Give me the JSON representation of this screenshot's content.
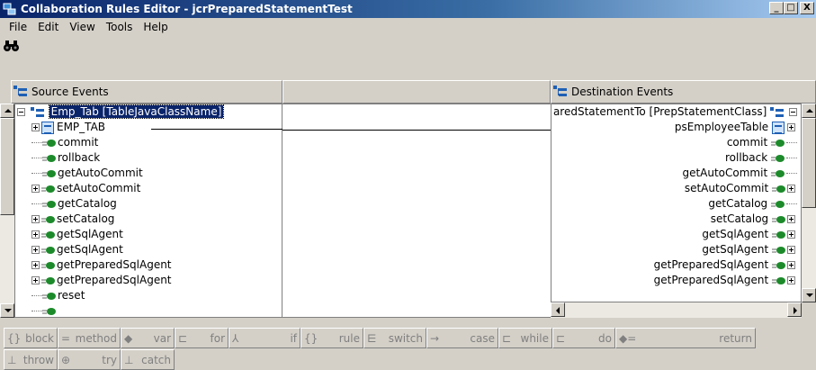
{
  "window": {
    "title": "Collaboration Rules Editor - jcrPreparedStatementTest",
    "minimize": "_",
    "maximize": "□",
    "close": "X"
  },
  "menu": [
    "File",
    "Edit",
    "View",
    "Tools",
    "Help"
  ],
  "toolbar": {
    "find_icon": "binoculars-icon"
  },
  "source": {
    "header": "Source Events",
    "root_label": "Emp_Tab [TableJavaClassName]",
    "items": [
      {
        "label": "EMP_TAB",
        "kind": "table",
        "expander": "plus"
      },
      {
        "label": "commit",
        "kind": "method",
        "expander": "none"
      },
      {
        "label": "rollback",
        "kind": "method",
        "expander": "none"
      },
      {
        "label": "getAutoCommit",
        "kind": "method",
        "expander": "none"
      },
      {
        "label": "setAutoCommit",
        "kind": "method",
        "expander": "plus"
      },
      {
        "label": "getCatalog",
        "kind": "method",
        "expander": "none"
      },
      {
        "label": "setCatalog",
        "kind": "method",
        "expander": "plus"
      },
      {
        "label": "getSqlAgent",
        "kind": "method",
        "expander": "plus"
      },
      {
        "label": "getSqlAgent",
        "kind": "method",
        "expander": "plus"
      },
      {
        "label": "getPreparedSqlAgent",
        "kind": "method",
        "expander": "plus"
      },
      {
        "label": "getPreparedSqlAgent",
        "kind": "method",
        "expander": "plus"
      },
      {
        "label": "reset",
        "kind": "method",
        "expander": "none"
      },
      {
        "label": "",
        "kind": "method",
        "expander": "none"
      }
    ]
  },
  "destination": {
    "header": "Destination Events",
    "root_label": "aredStatementTo [PrepStatementClass]",
    "items": [
      {
        "label": "psEmployeeTable",
        "kind": "table",
        "expander": "plus"
      },
      {
        "label": "commit",
        "kind": "method",
        "expander": "none"
      },
      {
        "label": "rollback",
        "kind": "method",
        "expander": "none"
      },
      {
        "label": "getAutoCommit",
        "kind": "method",
        "expander": "none"
      },
      {
        "label": "setAutoCommit",
        "kind": "method",
        "expander": "plus"
      },
      {
        "label": "getCatalog",
        "kind": "method",
        "expander": "none"
      },
      {
        "label": "setCatalog",
        "kind": "method",
        "expander": "plus"
      },
      {
        "label": "getSqlAgent",
        "kind": "method",
        "expander": "plus"
      },
      {
        "label": "getSqlAgent",
        "kind": "method",
        "expander": "plus"
      },
      {
        "label": "getPreparedSqlAgent",
        "kind": "method",
        "expander": "plus"
      },
      {
        "label": "getPreparedSqlAgent",
        "kind": "method",
        "expander": "plus"
      }
    ]
  },
  "palette": {
    "row1": [
      {
        "symbol": "{}",
        "label": "block"
      },
      {
        "symbol": "=",
        "label": "method"
      },
      {
        "symbol": "◆",
        "label": "var"
      },
      {
        "symbol": "⊏",
        "label": "for"
      },
      {
        "symbol": "⅄",
        "label": "if"
      },
      {
        "symbol": "{}",
        "label": "rule"
      },
      {
        "symbol": "⋿",
        "label": "switch"
      },
      {
        "symbol": "→",
        "label": "case"
      },
      {
        "symbol": "⊏",
        "label": "while"
      },
      {
        "symbol": "⊏",
        "label": "do"
      },
      {
        "symbol": "◆=",
        "label": "return"
      }
    ],
    "row2": [
      {
        "symbol": "⊥",
        "label": "throw"
      },
      {
        "symbol": "⊕",
        "label": "try"
      },
      {
        "symbol": "⊥",
        "label": "catch"
      }
    ]
  },
  "colors": {
    "title_gradient_start": "#0a246a",
    "selection": "#0a246a",
    "method_icon": "#1c8a2a"
  }
}
